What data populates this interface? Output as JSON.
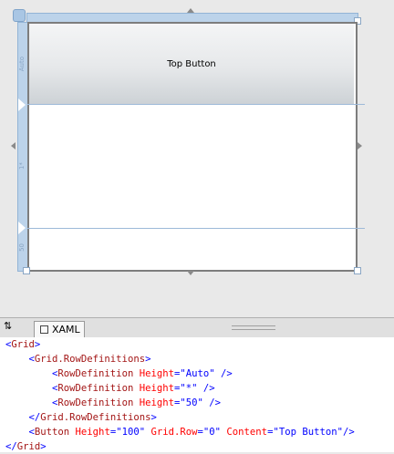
{
  "designer": {
    "button_label": "Top Button",
    "row_labels": [
      "Auto",
      "1*",
      "50"
    ]
  },
  "tabs": {
    "xaml_label": "XAML"
  },
  "code_lines": [
    [
      [
        "p",
        "<"
      ],
      [
        "t",
        "Grid"
      ],
      [
        "p",
        ">"
      ]
    ],
    [
      [
        "p",
        "    <"
      ],
      [
        "t",
        "Grid.RowDefinitions"
      ],
      [
        "p",
        ">"
      ]
    ],
    [
      [
        "p",
        "        <"
      ],
      [
        "t",
        "RowDefinition"
      ],
      [
        "a",
        " Height"
      ],
      [
        "p",
        "=\"Auto\" />"
      ]
    ],
    [
      [
        "p",
        "        <"
      ],
      [
        "t",
        "RowDefinition"
      ],
      [
        "a",
        " Height"
      ],
      [
        "p",
        "=\"*\" />"
      ]
    ],
    [
      [
        "p",
        "        <"
      ],
      [
        "t",
        "RowDefinition"
      ],
      [
        "a",
        " Height"
      ],
      [
        "p",
        "=\"50\" />"
      ]
    ],
    [
      [
        "p",
        "    </"
      ],
      [
        "t",
        "Grid.RowDefinitions"
      ],
      [
        "p",
        ">"
      ]
    ],
    [
      [
        "p",
        "    <"
      ],
      [
        "t",
        "Button"
      ],
      [
        "a",
        " Height"
      ],
      [
        "p",
        "=\"100\""
      ],
      [
        "a",
        " Grid.Row"
      ],
      [
        "p",
        "=\"0\""
      ],
      [
        "a",
        " Content"
      ],
      [
        "p",
        "=\"Top Button\"/>"
      ]
    ],
    [
      [
        "p",
        "</"
      ],
      [
        "t",
        "Grid"
      ],
      [
        "p",
        ">"
      ]
    ]
  ]
}
